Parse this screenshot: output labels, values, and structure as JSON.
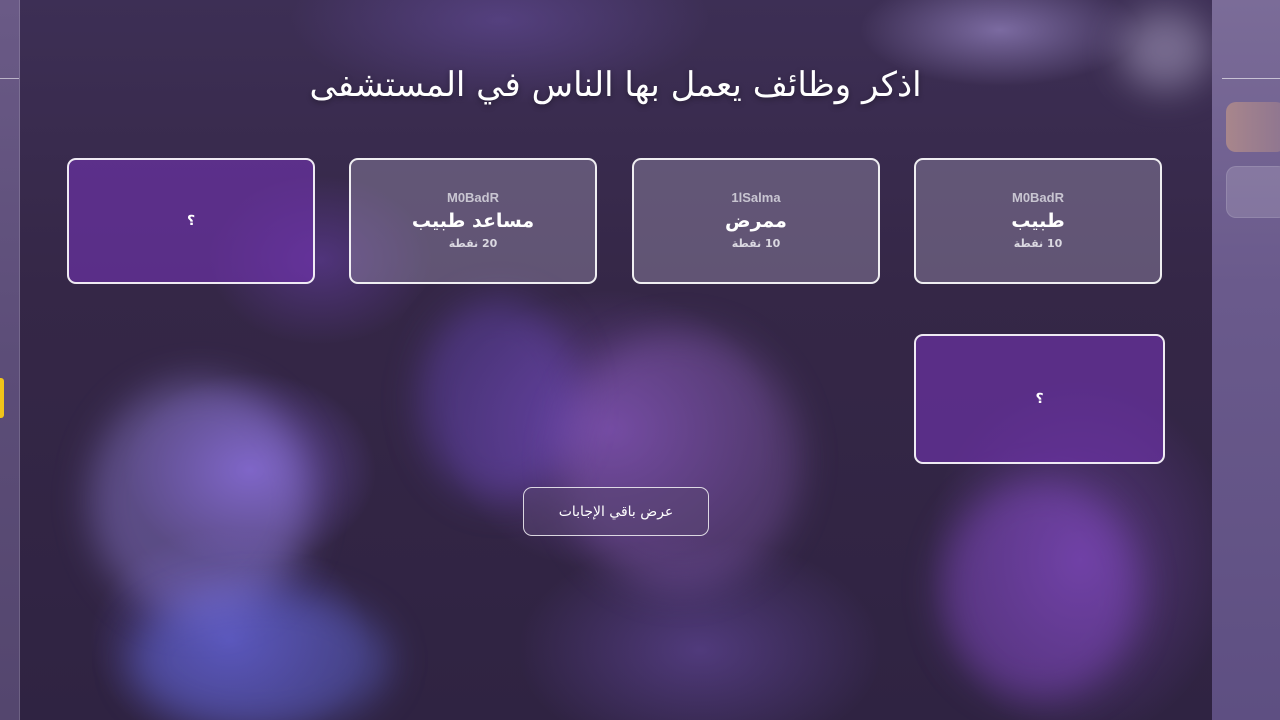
{
  "question": {
    "title": "اذكر وظائف يعمل بها الناس في المستشفى"
  },
  "answers": [
    {
      "player": "M0BadR",
      "answer": "طبيب",
      "points": "10 نقطة"
    },
    {
      "player": "1lSalma",
      "answer": "ممرض",
      "points": "10 نقطة"
    },
    {
      "player": "M0BadR",
      "answer": "مساعد طبيب",
      "points": "20 نقطة"
    },
    {
      "hidden_label": "؟"
    },
    {
      "hidden_label": "؟"
    }
  ],
  "actions": {
    "show_remaining_label": "عرض باقي الإجابات"
  },
  "colors": {
    "accent": "#f0c419",
    "card_hidden": "#6e32aa",
    "background": "#3a2b52"
  }
}
